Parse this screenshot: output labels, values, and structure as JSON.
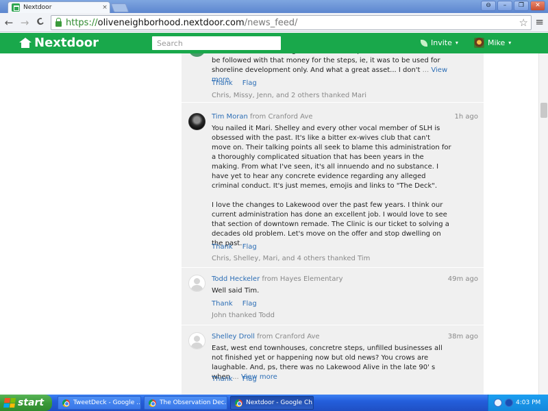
{
  "browser": {
    "tab_title": "Nextdoor",
    "tab_close": "×",
    "window_buttons": [
      "⊖",
      "–",
      "❐",
      "✕"
    ],
    "url_scheme": "https://",
    "url_host": "oliveneighborhood.nextdoor.com",
    "url_path": "/news_feed/",
    "back_glyph": "←",
    "forward_glyph": "→",
    "reload_glyph": "C",
    "star_glyph": "☆",
    "menu_glyph": "≡"
  },
  "header": {
    "logo_text": "Nextdoor",
    "search_placeholder": "Search",
    "invite_label": "Invite",
    "user_name": "Mike",
    "caret": "▾",
    "brand_color": "#19a84b"
  },
  "comments": [
    {
      "body_lines": [
        "I also remember hearing that there were specific rules that needed to be followed with that money for the steps, ie, it was to be used for shoreline development only. And what a great asset... I don't"
      ],
      "ellipsis": "...",
      "view_more": "View more",
      "thank_label": "Thank",
      "flag_label": "Flag",
      "thanked": "Chris, Missy, Jenn, and 2 others thanked Mari"
    },
    {
      "name": "Tim Moran",
      "from": "from Cranford Ave",
      "time": "1h ago",
      "paragraphs": [
        "You nailed it Mari. Shelley and every other vocal member of SLH is obsessed with the past. It's like a bitter ex-wives club that can't move on. Their talking points all seek to blame this administration for a thoroughly complicated situation that has been years in the making. From what I've seen, it's all innuendo and no substance. I have yet to hear any concrete evidence regarding any alleged criminal conduct. It's just memes, emojis and links to \"The Deck\".",
        "I love the changes to Lakewood over the past few years. I think our current administration has done an excellent job. I would love to see that section of downtown remade. The Clinic is our ticket to solving a decades old problem. Let's move on the offer and stop dwelling on the past."
      ],
      "thank_label": "Thank",
      "flag_label": "Flag",
      "thanked": "Chris, Shelley, Mari, and 4 others thanked Tim"
    },
    {
      "name": "Todd Heckeler",
      "from": "from Hayes Elementary",
      "time": "49m ago",
      "paragraphs": [
        "Well said Tim."
      ],
      "thank_label": "Thank",
      "flag_label": "Flag",
      "thanked": "John thanked Todd"
    },
    {
      "name": "Shelley Droll",
      "from": "from Cranford Ave",
      "time": "38m ago",
      "paragraphs": [
        "East, west end townhouses, concretre steps, unfilled businesses all not finished yet or happening now but old news? You crows are laughable. And, ps, there was no Lakewood Alive in the late 90' s when"
      ],
      "ellipsis": "...",
      "view_more": "View more",
      "thank_label": "Thank",
      "flag_label": "Flag"
    }
  ],
  "taskbar": {
    "start_label": "start",
    "tasks": [
      {
        "label": "TweetDeck - Google ..."
      },
      {
        "label": "The Observation Dec..."
      },
      {
        "label": "Nextdoor - Google Ch..."
      }
    ],
    "clock": "4:03 PM"
  }
}
